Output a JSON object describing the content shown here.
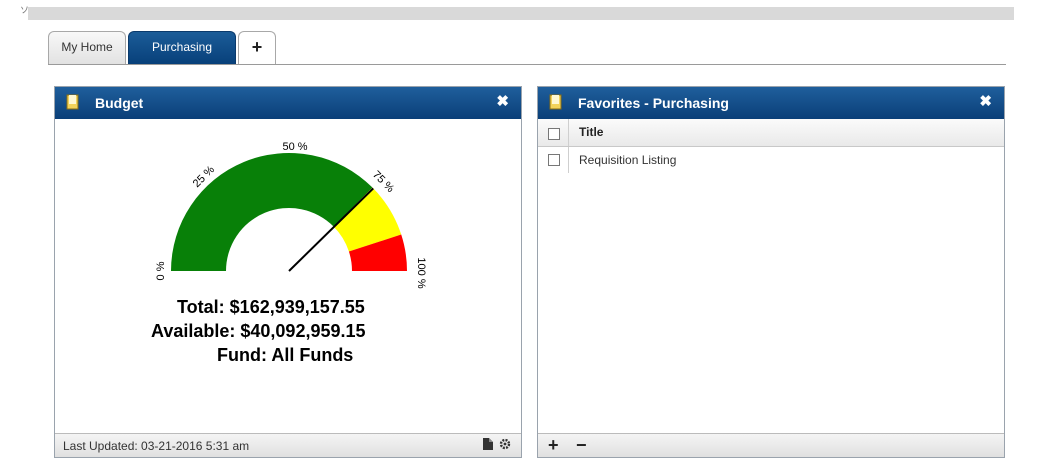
{
  "corner_mark": "ソ",
  "tabs": [
    {
      "label": "My Home"
    },
    {
      "label": "Purchasing"
    },
    {
      "label": "+"
    }
  ],
  "budget": {
    "title": "Budget",
    "close": "✖",
    "gauge": {
      "labels": {
        "p0": "0 %",
        "p25": "25 %",
        "p50": "50 %",
        "p75": "75 %",
        "p100": "100 %"
      },
      "needle_percent": 75.3,
      "bands": [
        {
          "from": 0,
          "to": 75,
          "color": "#088008"
        },
        {
          "from": 75,
          "to": 90,
          "color": "#ffff00"
        },
        {
          "from": 90,
          "to": 100,
          "color": "#ff0000"
        }
      ]
    },
    "total_label": "Total:",
    "total_value": "$162,939,157.55",
    "available_label": "Available:",
    "available_value": "$40,092,959.15",
    "fund_label": "Fund:",
    "fund_value": "All Funds",
    "footer": "Last Updated: 03-21-2016 5:31 am"
  },
  "favorites": {
    "title": "Favorites - Purchasing",
    "close": "✖",
    "column_title": "Title",
    "rows": [
      {
        "title": "Requisition Listing"
      }
    ],
    "add": "+",
    "remove": "−"
  },
  "colors": {
    "header_blue": "#0a3f78",
    "tab_active": "#08407a"
  }
}
